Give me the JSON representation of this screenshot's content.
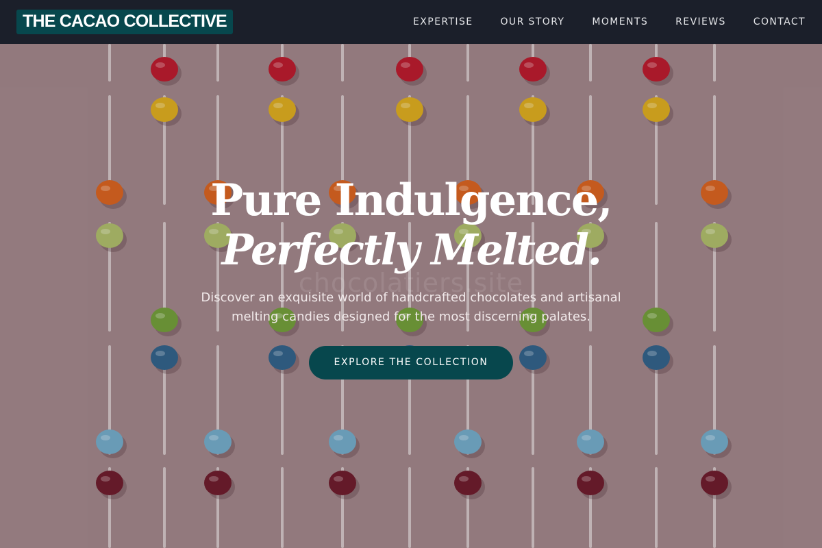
{
  "nav": {
    "brand": "THE CACAO COLLECTIVE",
    "links": [
      "EXPERTISE",
      "OUR STORY",
      "MOMENTS",
      "REVIEWS",
      "CONTACT"
    ]
  },
  "hero": {
    "headline_line1": "Pure Indulgence,",
    "headline_line2": "Perfectly Melted.",
    "ghost_text": "chocolatiers.site",
    "subtitle": "Discover an exquisite world of handcrafted chocolates and artisanal melting candies designed for the most discerning palates.",
    "cta_label": "EXPLORE THE COLLECTION",
    "background_image": "lollipops-on-pink-background"
  },
  "colors": {
    "nav_bg": "#1b1f2a",
    "brand_bg": "#07474d",
    "cta_bg": "#07474d",
    "hero_bg": "#9c8286",
    "candy": [
      "#b51a2c",
      "#d6a81e",
      "#d2601f",
      "#a9b868",
      "#6e9a38",
      "#2f5f86",
      "#6fa6c4",
      "#6a1b2b"
    ]
  }
}
